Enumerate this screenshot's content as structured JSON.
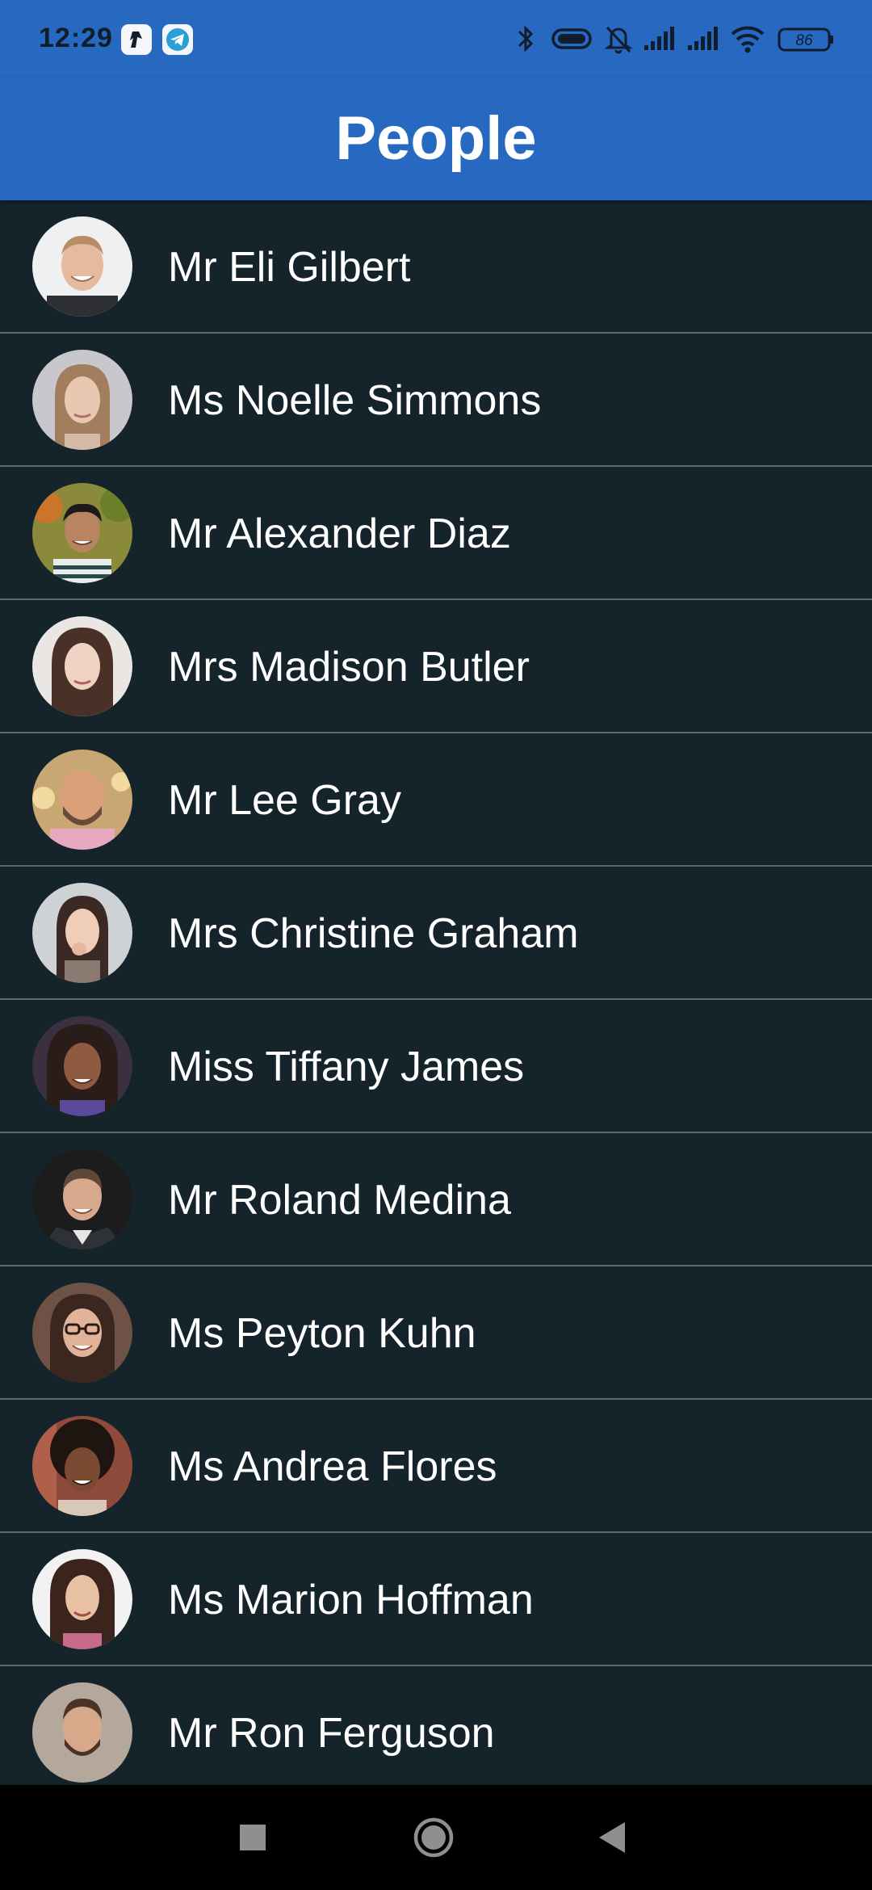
{
  "status_bar": {
    "time": "12:29",
    "battery_level": "86",
    "notification_icons": [
      "app-notification-icon",
      "telegram-icon"
    ],
    "system_icons": [
      "bluetooth-icon",
      "vibrate-icon",
      "mute-bell-icon",
      "signal-icon",
      "signal-icon",
      "wifi-icon",
      "battery-icon"
    ]
  },
  "app_bar": {
    "title": "People",
    "color": "#2769c0"
  },
  "people": [
    {
      "name": "Mr Eli Gilbert"
    },
    {
      "name": "Ms Noelle Simmons"
    },
    {
      "name": "Mr Alexander Diaz"
    },
    {
      "name": "Mrs Madison Butler"
    },
    {
      "name": "Mr Lee Gray"
    },
    {
      "name": "Mrs Christine Graham"
    },
    {
      "name": "Miss Tiffany James"
    },
    {
      "name": "Mr Roland Medina"
    },
    {
      "name": "Ms Peyton Kuhn"
    },
    {
      "name": "Ms Andrea Flores"
    },
    {
      "name": "Ms Marion Hoffman"
    },
    {
      "name": "Mr Ron Ferguson"
    }
  ],
  "nav_bar": {
    "buttons": [
      "recents-square-icon",
      "home-circle-icon",
      "back-triangle-icon"
    ]
  },
  "colors": {
    "background": "#15232b",
    "divider": "#5b6970",
    "text": "#ffffff"
  }
}
